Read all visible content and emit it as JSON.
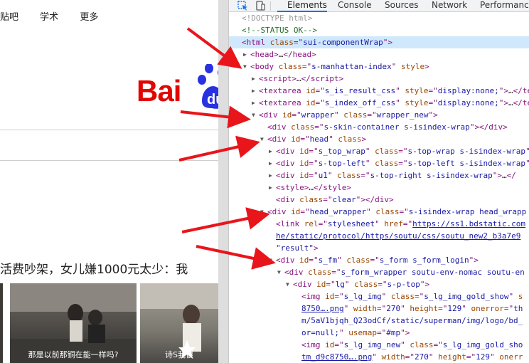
{
  "page": {
    "nav": [
      "贴吧",
      "学术",
      "更多"
    ],
    "logo_text": "Bai",
    "news_title": "活费吵架，女儿嫌1000元太少：我",
    "thumb_captions": [
      "那是以前那铜在能一样吗?",
      "诗S我很"
    ]
  },
  "devtools": {
    "tabs": [
      "Elements",
      "Console",
      "Sources",
      "Network",
      "Performance"
    ],
    "lines": [
      {
        "indent": 0,
        "html": "<span class='dt'>&lt;!DOCTYPE html&gt;</span>"
      },
      {
        "indent": 0,
        "html": "<span class='cm'>&lt;!--STATUS OK--&gt;</span>"
      },
      {
        "indent": 0,
        "sel": true,
        "html": "<span class='tag'>&lt;html</span> <span class='an'>class</span>=\"<span class='av'>sui-componentWrap</span>\"<span class='tag'>&gt;</span>"
      },
      {
        "indent": 1,
        "tri": "▶",
        "html": "<span class='tag'>&lt;head&gt;</span><span class='tx'>…</span><span class='tag'>&lt;/head&gt;</span>"
      },
      {
        "indent": 1,
        "tri": "▼",
        "html": "<span class='tag'>&lt;body</span> <span class='an'>class</span>=\"<span class='av'>s-manhattan-index</span>\" <span class='an'>style</span><span class='tag'>&gt;</span>"
      },
      {
        "indent": 2,
        "tri": "▶",
        "html": "<span class='tag'>&lt;script&gt;</span><span class='tx'>…</span><span class='tag'>&lt;/script&gt;</span>"
      },
      {
        "indent": 2,
        "tri": "▶",
        "html": "<span class='tag'>&lt;textarea</span> <span class='an'>id</span>=\"<span class='av'>s_is_result_css</span>\" <span class='an'>style</span>=\"<span class='av'>display:none;</span>\"<span class='tag'>&gt;</span><span class='tx'>…</span><span class='tag'>&lt;/te</span>"
      },
      {
        "indent": 2,
        "tri": "▶",
        "html": "<span class='tag'>&lt;textarea</span> <span class='an'>id</span>=\"<span class='av'>s_index_off_css</span>\" <span class='an'>style</span>=\"<span class='av'>display:none;</span>\"<span class='tag'>&gt;</span><span class='tx'>…</span><span class='tag'>&lt;/te</span>"
      },
      {
        "indent": 2,
        "tri": "▼",
        "html": "<span class='tag'>&lt;div</span> <span class='an'>id</span>=\"<span class='av'>wrapper</span>\" <span class='an'>class</span>=\"<span class='av'>wrapper_new</span>\"<span class='tag'>&gt;</span>"
      },
      {
        "indent": 3,
        "html": "<span class='tag'>&lt;div</span> <span class='an'>class</span>=\"<span class='av'>s-skin-container s-isindex-wrap</span>\"<span class='tag'>&gt;&lt;/div&gt;</span>"
      },
      {
        "indent": 3,
        "tri": "▼",
        "html": "<span class='tag'>&lt;div</span> <span class='an'>id</span>=\"<span class='av'>head</span>\" <span class='an'>class</span><span class='tag'>&gt;</span>"
      },
      {
        "indent": 4,
        "tri": "▶",
        "html": "<span class='tag'>&lt;div</span> <span class='an'>id</span>=\"<span class='av'>s_top_wrap</span>\" <span class='an'>class</span>=\"<span class='av'>s-top-wrap s-isindex-wrap</span>\""
      },
      {
        "indent": 4,
        "tri": "▶",
        "html": "<span class='tag'>&lt;div</span> <span class='an'>id</span>=\"<span class='av'>s-top-left</span>\" <span class='an'>class</span>=\"<span class='av'>s-top-left s-isindex-wrap</span>\""
      },
      {
        "indent": 4,
        "tri": "▶",
        "html": "<span class='tag'>&lt;div</span> <span class='an'>id</span>=\"<span class='av'>u1</span>\" <span class='an'>class</span>=\"<span class='av'>s-top-right s-isindex-wrap</span>\"<span class='tag'>&gt;</span><span class='tx'>…</span><span class='tag'>&lt;/</span>"
      },
      {
        "indent": 4,
        "tri": "▶",
        "html": "<span class='tag'>&lt;style&gt;</span><span class='tx'>…</span><span class='tag'>&lt;/style&gt;</span>"
      },
      {
        "indent": 4,
        "html": "<span class='tag'>&lt;div</span> <span class='an'>class</span>=\"<span class='av'>clear</span>\"<span class='tag'>&gt;&lt;/div&gt;</span>"
      },
      {
        "indent": 3,
        "tri": "▼",
        "html": "<span class='tag'>&lt;div</span> <span class='an'>id</span>=\"<span class='av'>head_wrapper</span>\" <span class='an'>class</span>=\"<span class='av'>s-isindex-wrap head_wrapp</span>"
      },
      {
        "indent": 4,
        "html": "<span class='tag'>&lt;link</span> <span class='an'>rel</span>=\"<span class='av'>stylesheet</span>\" <span class='an'>href</span>=\"<span class='lk'>https://ss1.bdstatic.com</span>"
      },
      {
        "indent": 4,
        "html": "<span class='lk'>he/static/protocol/https/soutu/css/soutu_new2_b3a7e9</span>"
      },
      {
        "indent": 4,
        "html": "<span class='av'>\"result\"</span><span class='tag'>&gt;</span>"
      },
      {
        "indent": 4,
        "tri": "▼",
        "html": "<span class='tag'>&lt;div</span> <span class='an'>id</span>=\"<span class='av'>s_fm</span>\" <span class='an'>class</span>=\"<span class='av'>s_form s_form_login</span>\"<span class='tag'>&gt;</span>"
      },
      {
        "indent": 5,
        "tri": "▼",
        "html": "<span class='tag'>&lt;div</span> <span class='an'>class</span>=\"<span class='av'>s_form_wrapper soutu-env-nomac soutu-en</span>"
      },
      {
        "indent": 6,
        "tri": "▼",
        "html": "<span class='tag'>&lt;div</span> <span class='an'>id</span>=\"<span class='av'>lg</span>\" <span class='an'>class</span>=\"<span class='av'>s-p-top</span>\"<span class='tag'>&gt;</span>"
      },
      {
        "indent": 7,
        "html": "<span class='tag'>&lt;img</span> <span class='an'>id</span>=\"<span class='av'>s_lg_img</span>\" <span class='an'>class</span>=\"<span class='av'>s_lg_img_gold_show</span>\" <span class='an'>s</span>"
      },
      {
        "indent": 7,
        "html": "<span class='lk'>8750….png</span>\" <span class='an'>width</span>=\"<span class='av'>270</span>\" <span class='an'>height</span>=\"<span class='av'>129</span>\" <span class='an'>onerror</span>=\"<span class='av'>th</span>"
      },
      {
        "indent": 7,
        "html": "<span class='av'>m/5aV1bjqh_Q23odCf/static/superman/img/logo/bd_</span>"
      },
      {
        "indent": 7,
        "html": "<span class='av'>or=null;</span>\" <span class='an'>usemap</span>=\"<span class='av'>#mp</span>\"<span class='tag'>&gt;</span>"
      },
      {
        "indent": 7,
        "html": "<span class='tag'>&lt;img</span> <span class='an'>id</span>=\"<span class='av'>s_lg_img_new</span>\" <span class='an'>class</span>=\"<span class='av'>s_lg_img_gold_sho</span>"
      },
      {
        "indent": 7,
        "html": "<span class='lk'>tm_d9c8750….png</span>\" <span class='an'>width</span>=\"<span class='av'>270</span>\" <span class='an'>height</span>=\"<span class='av'>129</span>\" <span class='an'>onerr</span>"
      }
    ]
  },
  "colors": {
    "arrow": "#e8151b",
    "devtools_accent": "#1a73e8",
    "selection": "#cfe8fc",
    "baidu_red": "#e10602",
    "baidu_blue": "#2932e1"
  }
}
